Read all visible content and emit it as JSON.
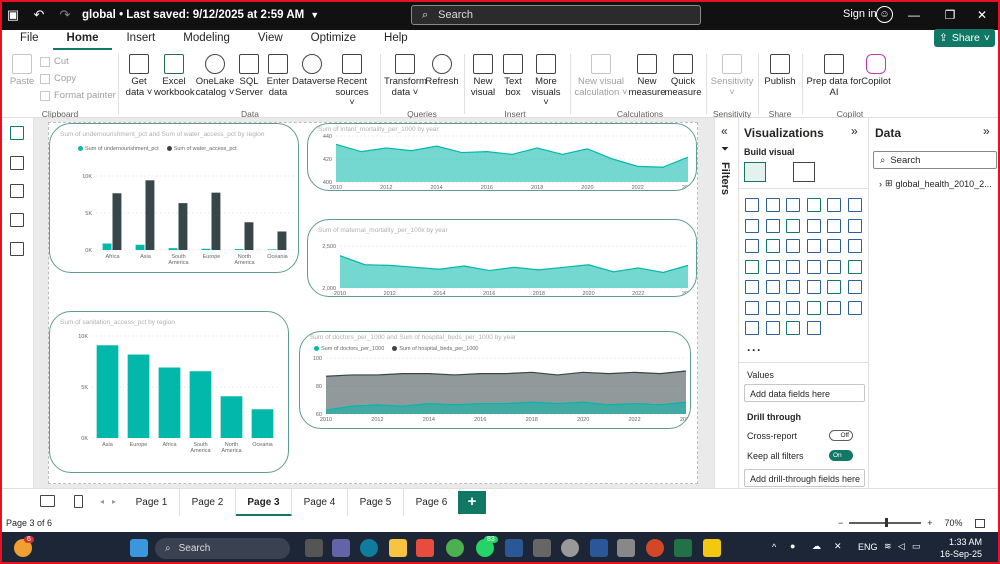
{
  "titlebar": {
    "file_title": "global",
    "saved": "Last saved: 9/12/2025 at 2:59 AM",
    "search_placeholder": "Search",
    "signin": "Sign in"
  },
  "menu": {
    "tabs": [
      "File",
      "Home",
      "Insert",
      "Modeling",
      "View",
      "Optimize",
      "Help"
    ],
    "active": "Home",
    "share": "Share"
  },
  "ribbon": {
    "clipboard": {
      "paste": "Paste",
      "cut": "Cut",
      "copy": "Copy",
      "format_painter": "Format painter",
      "group": "Clipboard"
    },
    "data": {
      "get_data": [
        "Get",
        "data ˅"
      ],
      "excel": [
        "Excel",
        "workbook"
      ],
      "onelake": [
        "OneLake",
        "catalog ˅"
      ],
      "sql": [
        "SQL",
        "Server"
      ],
      "enter": [
        "Enter",
        "data"
      ],
      "dataverse": [
        "Dataverse",
        ""
      ],
      "recent": [
        "Recent",
        "sources ˅"
      ],
      "group": "Data"
    },
    "queries": {
      "transform": [
        "Transform",
        "data ˅"
      ],
      "refresh": [
        "Refresh",
        ""
      ],
      "group": "Queries"
    },
    "insert": {
      "new_visual": [
        "New",
        "visual"
      ],
      "text_box": [
        "Text",
        "box"
      ],
      "more_visuals": [
        "More",
        "visuals ˅"
      ],
      "group": "Insert"
    },
    "calculations": {
      "new_visual_calc": [
        "New visual",
        "calculation ˅"
      ],
      "new_measure": [
        "New",
        "measure"
      ],
      "quick_measure": [
        "Quick",
        "measure"
      ],
      "group": "Calculations"
    },
    "sensitivity": {
      "label": [
        "Sensitivity",
        "˅"
      ],
      "group": "Sensitivity"
    },
    "share": {
      "publish": [
        "Publish",
        ""
      ],
      "group": "Share"
    },
    "copilot": {
      "prep": [
        "Prep data for",
        "AI"
      ],
      "copilot": [
        "Copilot",
        ""
      ],
      "group": "Copilot"
    }
  },
  "visuals": {
    "v1": {
      "title": "Sum of undernourishment_pct and Sum of water_access_pct by region",
      "legend": [
        "Sum of undernourishment_pct",
        "Sum of water_access_pct"
      ],
      "yticks": [
        "10K",
        "5K",
        "0K"
      ]
    },
    "v2": {
      "title": "Sum of infant_mortality_per_1000 by year",
      "yticks": [
        "440",
        "420",
        "400"
      ]
    },
    "v3": {
      "title": "Sum of maternal_mortality_per_100k by year",
      "yticks": [
        "2,500",
        "2,000"
      ]
    },
    "v4": {
      "title": "Sum of sanitation_access_pct by region",
      "yticks": [
        "10K",
        "5K",
        "0K"
      ]
    },
    "v5": {
      "title": "Sum of doctors_per_1000 and Sum of hospital_beds_per_1000 by year",
      "legend": [
        "Sum of doctors_per_1000",
        "Sum of hospital_beds_per_1000"
      ],
      "yticks": [
        "100",
        "80",
        "60"
      ]
    }
  },
  "chart_data": [
    {
      "type": "bar",
      "title": "Sum of undernourishment_pct and Sum of water_access_pct by region",
      "categories": [
        "Africa",
        "Asia",
        "South America",
        "Europe",
        "North America",
        "Oceania"
      ],
      "series": [
        {
          "name": "Sum of undernourishment_pct",
          "values": [
            1050,
            850,
            300,
            200,
            150,
            100
          ]
        },
        {
          "name": "Sum of water_access_pct",
          "values": [
            9200,
            11300,
            7600,
            9300,
            4500,
            3000
          ]
        }
      ],
      "ylim": [
        0,
        12000
      ],
      "colors": [
        "#01b8aa",
        "#374649"
      ]
    },
    {
      "type": "area",
      "title": "Sum of infant_mortality_per_1000 by year",
      "x": [
        2010,
        2011,
        2012,
        2013,
        2014,
        2015,
        2016,
        2017,
        2018,
        2019,
        2020,
        2021,
        2022,
        2023,
        2024
      ],
      "values": [
        436,
        428,
        432,
        429,
        434,
        427,
        428,
        425,
        432,
        425,
        431,
        420,
        412,
        411,
        422
      ],
      "ylim": [
        395,
        445
      ],
      "xticks": [
        "2010",
        "2012",
        "2014",
        "2016",
        "2018",
        "2020",
        "2022",
        "2024"
      ],
      "colors": [
        "#01b8aa"
      ]
    },
    {
      "type": "area",
      "title": "Sum of maternal_mortality_per_100k by year",
      "x": [
        2010,
        2011,
        2012,
        2013,
        2014,
        2015,
        2016,
        2017,
        2018,
        2019,
        2020,
        2021,
        2022,
        2023,
        2024
      ],
      "values": [
        2450,
        2310,
        2300,
        2270,
        2240,
        2290,
        2220,
        2270,
        2230,
        2270,
        2310,
        2200,
        2260,
        2190,
        2300
      ],
      "ylim": [
        1950,
        2600
      ],
      "xticks": [
        "2010",
        "2012",
        "2014",
        "2016",
        "2018",
        "2020",
        "2022",
        "2024"
      ],
      "colors": [
        "#01b8aa"
      ]
    },
    {
      "type": "bar",
      "title": "Sum of sanitation_access_pct by region",
      "categories": [
        "Asia",
        "Europe",
        "Africa",
        "South America",
        "North America",
        "Oceania"
      ],
      "values": [
        10000,
        9000,
        7600,
        7200,
        4500,
        3100
      ],
      "ylim": [
        0,
        11000
      ],
      "colors": [
        "#01b8aa"
      ]
    },
    {
      "type": "area",
      "title": "Sum of doctors_per_1000 and Sum of hospital_beds_per_1000 by year",
      "x": [
        2010,
        2011,
        2012,
        2013,
        2014,
        2015,
        2016,
        2017,
        2018,
        2019,
        2020,
        2021,
        2022,
        2023,
        2024
      ],
      "series": [
        {
          "name": "Sum of doctors_per_1000",
          "values": [
            61,
            64,
            65,
            64,
            66,
            65,
            66,
            66,
            67,
            66,
            67,
            65,
            66,
            65,
            67
          ]
        },
        {
          "name": "Sum of hospital_beds_per_1000",
          "values": [
            87,
            88,
            88,
            89,
            89,
            88,
            89,
            89,
            90,
            88,
            90,
            89,
            90,
            89,
            91
          ]
        }
      ],
      "ylim": [
        58,
        101
      ],
      "xticks": [
        "2010",
        "2012",
        "2014",
        "2016",
        "2018",
        "2020",
        "2022",
        "2024"
      ],
      "colors": [
        "#01b8aa",
        "#374649"
      ]
    }
  ],
  "filters": {
    "label": "Filters"
  },
  "viz_pane": {
    "title": "Visualizations",
    "build_visual": "Build visual",
    "values_label": "Values",
    "add_fields": "Add data fields here",
    "drill_through": "Drill through",
    "cross_report": "Cross-report",
    "cross_report_state": "Off",
    "keep_filters": "Keep all filters",
    "keep_filters_state": "On",
    "add_drill": "Add drill-through fields here"
  },
  "data_pane": {
    "title": "Data",
    "search_placeholder": "Search",
    "table": "global_health_2010_2..."
  },
  "pages": [
    "Page 1",
    "Page 2",
    "Page 3",
    "Page 4",
    "Page 5",
    "Page 6"
  ],
  "active_page": "Page 3",
  "status": {
    "page_of": "Page 3 of 6",
    "zoom": "70%"
  },
  "taskbar": {
    "search": "Search",
    "badge_weather": "6",
    "badge_whatsapp": "83",
    "lang": "ENG",
    "time": "1:33 AM",
    "date": "16-Sep-25"
  },
  "colors": {
    "accent": "#117865",
    "teal": "#01b8aa",
    "dark": "#374649",
    "frame": "#e81123"
  }
}
